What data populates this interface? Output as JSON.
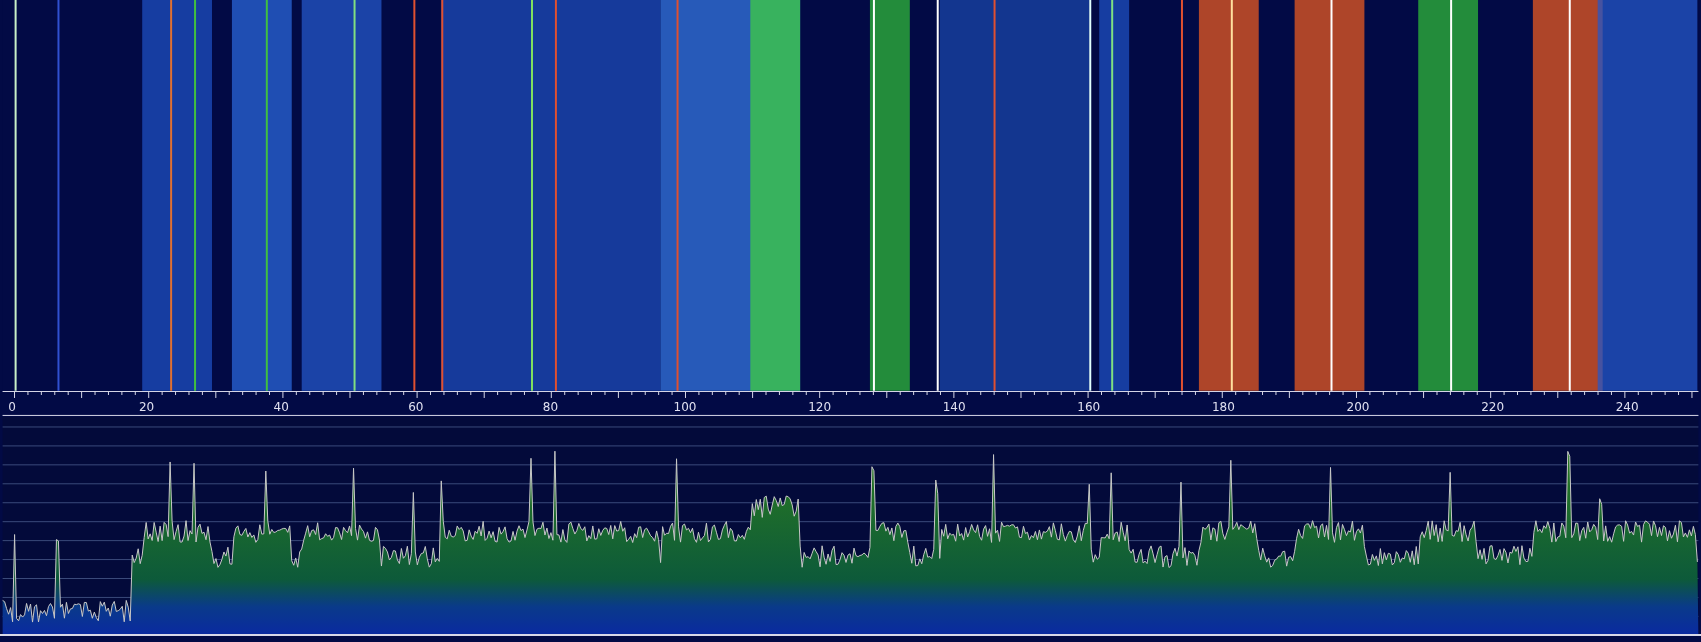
{
  "frequency_axis": {
    "labels": [
      "0",
      "20",
      "40",
      "60",
      "80",
      "100",
      "120",
      "140",
      "160",
      "180",
      "200",
      "220",
      "240"
    ]
  }
}
